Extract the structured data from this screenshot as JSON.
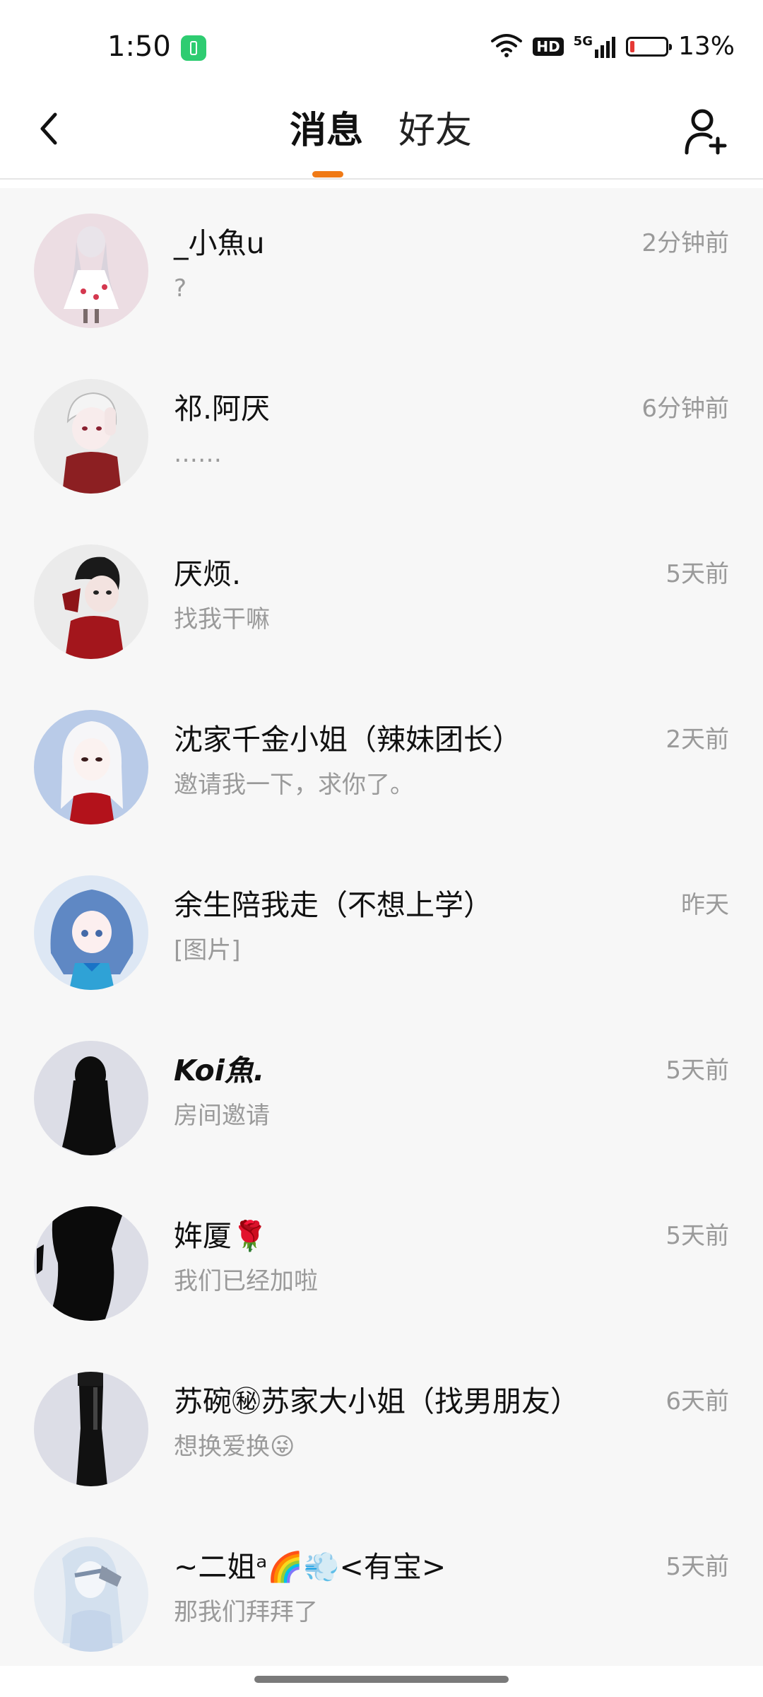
{
  "status_bar": {
    "time": "1:50",
    "network": "5G",
    "hd": "HD",
    "battery_percent": "13%",
    "battery_level": 0.13,
    "battery_app_color": "#2ecc71"
  },
  "header": {
    "back_icon": "chevron-left-icon",
    "tabs": [
      {
        "label": "消息",
        "active": true
      },
      {
        "label": "好友",
        "active": false
      }
    ],
    "add_friend_icon": "add-user-icon",
    "accent_color": "#f07a16"
  },
  "conversations": [
    {
      "name": "_小魚u",
      "preview": "?",
      "time": "2分钟前"
    },
    {
      "name": "祁.阿厌",
      "preview": "……",
      "time": "6分钟前"
    },
    {
      "name": "厌烦.",
      "preview": "找我干嘛",
      "time": "5天前"
    },
    {
      "name": "沈家千金小姐（辣妹团长）",
      "preview": "邀请我一下，求你了。",
      "time": "2天前"
    },
    {
      "name": "余生陪我走（不想上学）",
      "preview": "[图片]",
      "time": "昨天"
    },
    {
      "name": "Koi魚.",
      "preview": "房间邀请",
      "time": "5天前"
    },
    {
      "name": "姩厦🌹",
      "preview": "我们已经加啦",
      "time": "5天前"
    },
    {
      "name": "苏碗㊙苏家大小姐（找男朋友）",
      "preview": "想换爱换😜",
      "time": "6天前"
    },
    {
      "name": "~二姐ᵃ🌈💨<有宝>",
      "preview": "那我们拜拜了",
      "time": "5天前"
    }
  ]
}
